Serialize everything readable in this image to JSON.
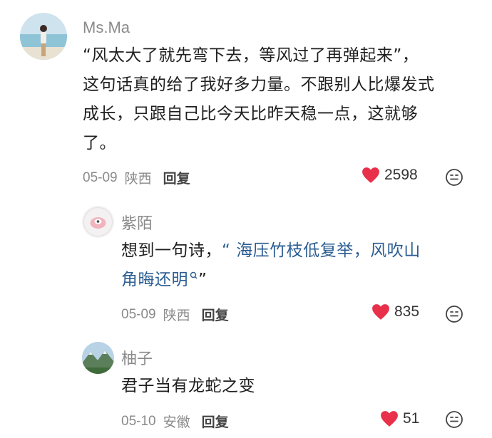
{
  "comments": [
    {
      "author": "Ms.Ma",
      "text_lines": [
        "“风太大了就先弯下去，等风过了再弹起来”，",
        "这句话真的给了我好多力量。不跟别人比爆发式",
        "成长，只跟自己比今天比昨天稳一点，这就够",
        "了。"
      ],
      "date": "05-09",
      "location": "陕西",
      "reply_label": "回复",
      "likes": "2598"
    },
    {
      "author": "紫陌",
      "text_prefix": "想到一句诗，",
      "quote_line1": "“ 海压竹枝低复举，风吹山",
      "quote_line2": "角晦还明",
      "quote_end": "”",
      "date": "05-09",
      "location": "陕西",
      "reply_label": "回复",
      "likes": "835"
    },
    {
      "author": "柚子",
      "text": "君子当有龙蛇之变",
      "date": "05-10",
      "location": "安徽",
      "reply_label": "回复",
      "likes": "51"
    }
  ],
  "colors": {
    "heart": "#e8304a",
    "link": "#2b5d92",
    "meta": "#8a8a8a"
  }
}
